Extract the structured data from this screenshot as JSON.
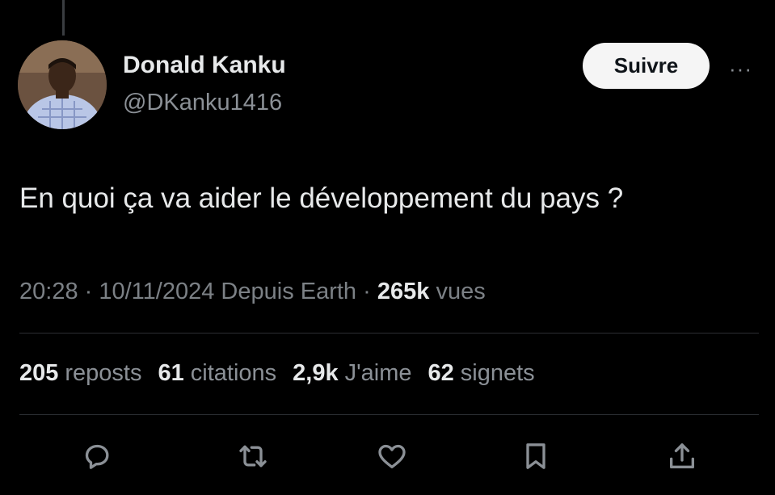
{
  "author": {
    "name": "Donald Kanku",
    "handle": "@DKanku1416"
  },
  "follow_label": "Suivre",
  "more_label": "···",
  "tweet": {
    "text": "En quoi ça va aider le développement du pays ?",
    "time": "20:28",
    "date": "10/11/2024",
    "source": "Depuis Earth",
    "views_count": "265k",
    "views_label": "vues"
  },
  "stats": [
    {
      "count": "205",
      "label": "reposts"
    },
    {
      "count": "61",
      "label": "citations"
    },
    {
      "count": "2,9k",
      "label": "J'aime"
    },
    {
      "count": "62",
      "label": "signets"
    }
  ],
  "actions": [
    "reply-icon",
    "retweet-icon",
    "like-icon",
    "bookmark-icon",
    "share-icon"
  ],
  "colors": {
    "background": "#000000",
    "primary_text": "#e7e9ea",
    "secondary_text": "#8b9096",
    "divider": "#2c2f33",
    "follow_button_bg": "#f5f5f5"
  }
}
